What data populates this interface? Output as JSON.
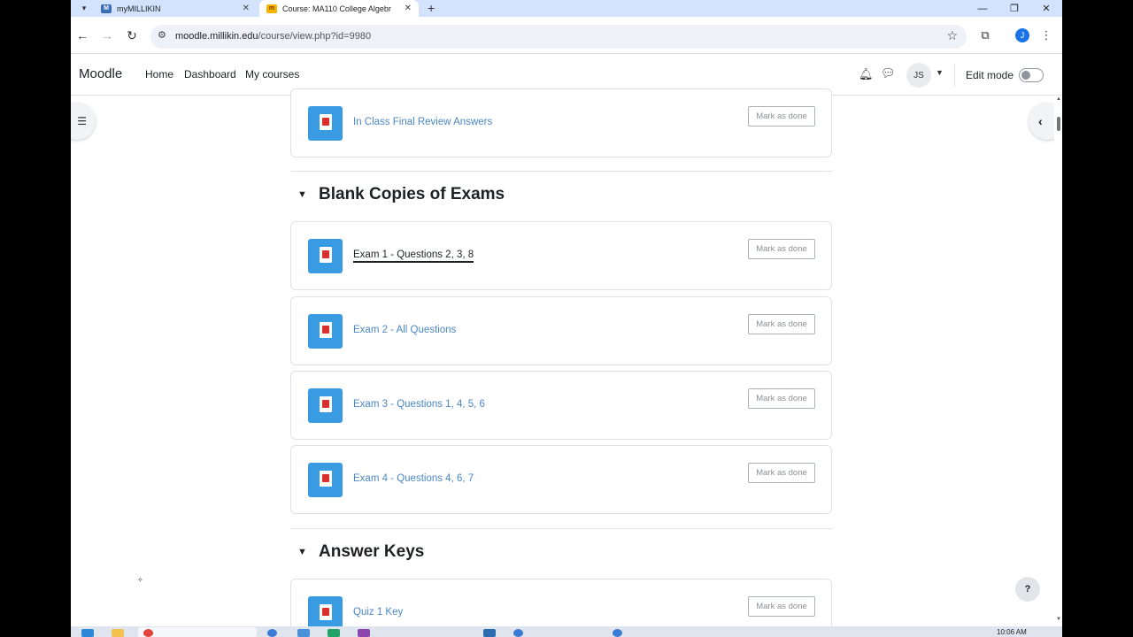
{
  "browser": {
    "tabs": [
      {
        "title": "myMILLIKIN",
        "favicon": "millikin-icon"
      },
      {
        "title": "Course: MA110 College Algebr",
        "favicon": "moodle-icon",
        "active": true
      }
    ],
    "url_host": "moodle.millikin.edu",
    "url_path": "/course/view.php?id=9980",
    "profile_initial": "J",
    "profile_color": "#1a73e8"
  },
  "moodle": {
    "brand": "Moodle",
    "nav": [
      "Home",
      "Dashboard",
      "My courses"
    ],
    "avatar_initials": "JS",
    "edit_mode_label": "Edit mode",
    "edit_mode_on": false
  },
  "content": {
    "mark_label": "Mark as done",
    "top_item": "In Class Final Review Answers",
    "sections": [
      {
        "title": "Blank Copies of Exams",
        "items": [
          "Exam 1 - Questions 2, 3, 8",
          "Exam 2 - All Questions",
          "Exam 3 - Questions 1, 4, 5, 6",
          "Exam 4 - Questions 4, 6, 7"
        ]
      },
      {
        "title": "Answer Keys",
        "items": [
          "Quiz 1 Key"
        ]
      }
    ],
    "help_label": "?",
    "link_color": "#4b87c6",
    "pdf_icon_color": "#399be2"
  },
  "taskbar": {
    "time": "10:06 AM"
  }
}
